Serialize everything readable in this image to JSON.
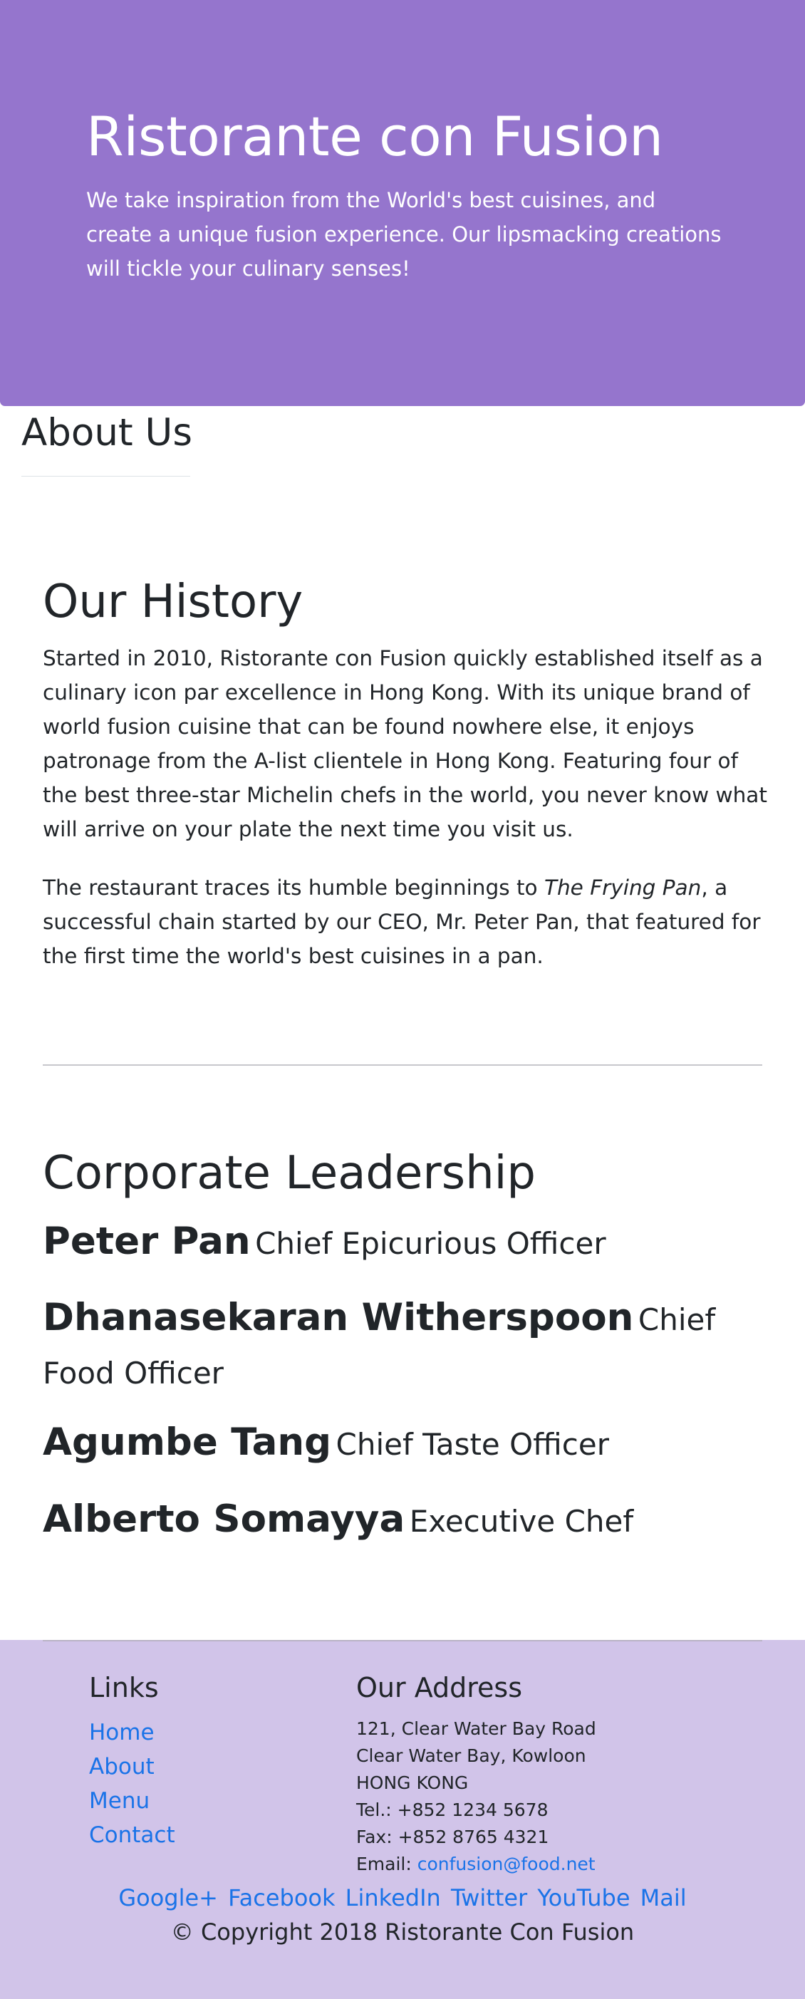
{
  "jumbotron": {
    "title": "Ristorante con Fusion",
    "tagline": "We take inspiration from the World's best cuisines, and create a unique fusion experience. Our lipsmacking creations will tickle your culinary senses!"
  },
  "about": {
    "title": "About Us"
  },
  "history": {
    "title": "Our History",
    "paragraph1": "Started in 2010, Ristorante con Fusion quickly established itself as a culinary icon par excellence in Hong Kong. With its unique brand of world fusion cuisine that can be found nowhere else, it enjoys patronage from the A-list clientele in Hong Kong. Featuring four of the best three-star Michelin chefs in the world, you never know what will arrive on your plate the next time you visit us.",
    "paragraph2_before": "The restaurant traces its humble beginnings to ",
    "paragraph2_em": "The Frying Pan",
    "paragraph2_after": ", a successful chain started by our CEO, Mr. Peter Pan, that featured for the first time the world's best cuisines in a pan."
  },
  "leadership": {
    "title": "Corporate Leadership",
    "leaders": [
      {
        "name": "Peter Pan",
        "role": "Chief Epicurious Officer"
      },
      {
        "name": "Dhanasekaran Witherspoon",
        "role": "Chief Food Officer"
      },
      {
        "name": "Agumbe Tang",
        "role": "Chief Taste Officer"
      },
      {
        "name": "Alberto Somayya",
        "role": "Executive Chef"
      }
    ]
  },
  "footer": {
    "links_title": "Links",
    "links": [
      "Home",
      "About",
      "Menu",
      "Contact"
    ],
    "address_title": "Our Address",
    "address_lines": [
      "121, Clear Water Bay Road",
      "Clear Water Bay, Kowloon",
      "HONG KONG",
      "Tel.: +852 1234 5678",
      "Fax: +852 8765 4321"
    ],
    "email_label": "Email: ",
    "email": "confusion@food.net",
    "social": [
      "Google+",
      "Facebook",
      "LinkedIn",
      "Twitter",
      "YouTube",
      "Mail"
    ],
    "copyright": "© Copyright 2018 Ristorante Con Fusion"
  },
  "colors": {
    "jumbotron_bg": "#9575cd",
    "footer_bg": "#d1c4e9",
    "link": "#1a73e8"
  }
}
